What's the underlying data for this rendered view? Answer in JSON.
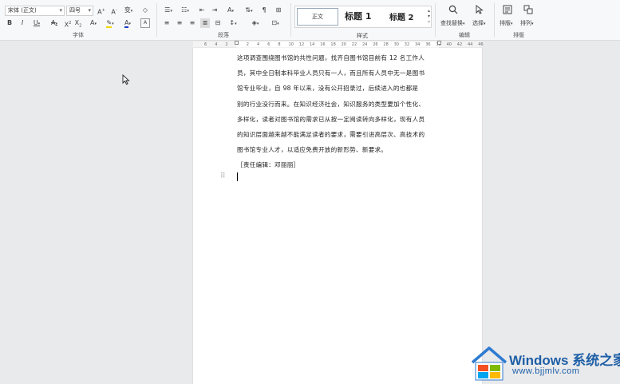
{
  "ribbon": {
    "font_group": {
      "label": "字体",
      "font_name": "宋体 (正文)",
      "font_size": "四号"
    },
    "paragraph_group": {
      "label": "段落"
    },
    "styles_group": {
      "label": "样式",
      "normal": "正文",
      "heading1": "标题 1",
      "heading2": "标题 2"
    },
    "find_group": {
      "label": "编辑",
      "find_replace": "查找替换",
      "select": "选择"
    },
    "arrange_group": {
      "label": "排版",
      "layout": "排版",
      "sort": "排列"
    },
    "colors": {
      "highlight": "#f2d600",
      "font_color": "#1a3cc8",
      "accent": "#2f6fd6"
    }
  },
  "ruler": {
    "ticks": [
      "6",
      "4",
      "2",
      "",
      "2",
      "4",
      "6",
      "8",
      "10",
      "12",
      "14",
      "16",
      "18",
      "20",
      "22",
      "24",
      "26",
      "28",
      "30",
      "32",
      "34",
      "36",
      "38",
      "40",
      "42",
      "44",
      "46"
    ]
  },
  "document": {
    "lines": [
      "这项调查围绕图书馆的共性问题，找齐自图书馆目前有 12 名工作人",
      "员，其中全日制本科毕业人员只有一人，而且所有人员中无一是图书",
      "馆专业毕业，自 98 年以来，没有公开招录过，后续进入的也都是",
      "别的行业没行而来。在知识经济社会，知识服务的类型要加个性化、",
      "多样化，读者对图书馆的需求已从按一定阅读转向多样化，现有人员",
      "的知识层面越来越不能满足读者的要求，需要引进高层次、高技术的",
      "图书馆专业人才，以适应免费开放的新形势、新要求。"
    ],
    "editor_note": "［责任编辑：邓丽丽］"
  },
  "watermark": {
    "title": "Windows 系统之家",
    "url": "www.bjjmlv.com"
  }
}
